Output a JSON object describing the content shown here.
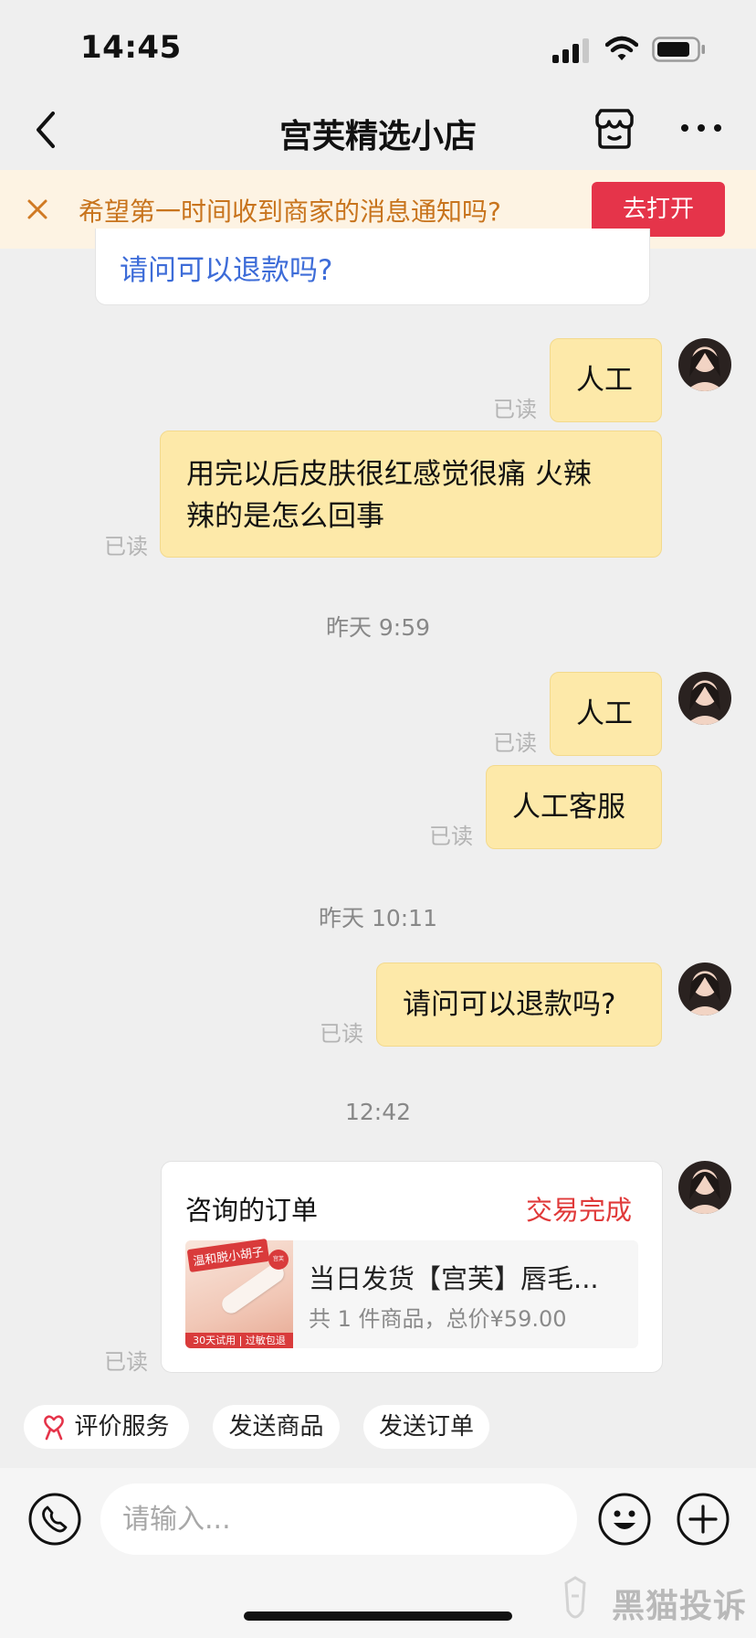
{
  "status_bar": {
    "time": "14:45"
  },
  "nav": {
    "title": "宫芙精选小店"
  },
  "notice": {
    "text": "希望第一时间收到商家的消息通知吗?",
    "button": "去打开"
  },
  "chat": {
    "previous_card_text": "请问可以退款吗?",
    "read_label": "已读",
    "messages": [
      {
        "text": "人工"
      },
      {
        "text_line1": "用完以后皮肤很红感觉很痛 火辣",
        "text_line2": "辣的是怎么回事"
      },
      {
        "time": "昨天 9:59"
      },
      {
        "text": "人工"
      },
      {
        "text": "人工客服"
      },
      {
        "time": "昨天 10:11"
      },
      {
        "text": "请问可以退款吗?"
      },
      {
        "time": "12:42"
      }
    ],
    "order_card": {
      "title": "咨询的订单",
      "status": "交易完成",
      "product_name": "当日发货【宫芙】唇毛...",
      "product_meta": "共 1 件商品，总价¥59.00",
      "thumb_tag": "温和脱小胡子",
      "thumb_badge": "宫芙",
      "thumb_footer": "30天试用 | 过敏包退"
    }
  },
  "quick_actions": [
    {
      "label": "评价服务"
    },
    {
      "label": "发送商品"
    },
    {
      "label": "发送订单"
    }
  ],
  "input": {
    "placeholder": "请输入..."
  },
  "watermark": "黑猫投诉",
  "colors": {
    "accent": "#e5344a",
    "bubble": "#fde9a9",
    "notice_text": "#c8741d",
    "status_red": "#e03a3a"
  }
}
